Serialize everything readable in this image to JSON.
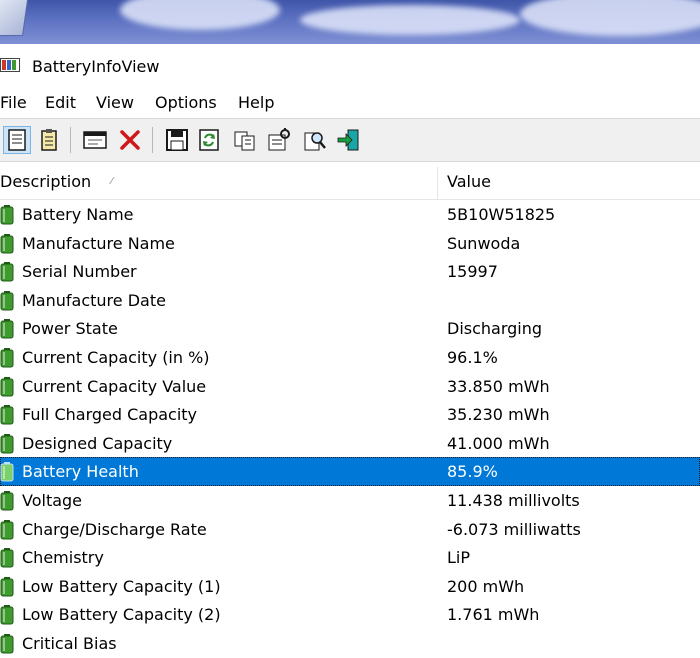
{
  "window": {
    "title": "BatteryInfoView"
  },
  "menu": [
    "File",
    "Edit",
    "View",
    "Options",
    "Help"
  ],
  "toolbar": [
    "properties-icon",
    "html-report-icon",
    "options-window-icon",
    "delete-icon",
    "save-icon",
    "refresh-icon",
    "copy-icon",
    "properties-dialog-icon",
    "find-icon",
    "exit-icon"
  ],
  "columns": {
    "description": "Description",
    "value": "Value"
  },
  "colors": {
    "selection": "#0078d7",
    "battery_green": "#3f9a2f"
  },
  "rows": [
    {
      "description": "Battery Name",
      "value": "5B10W51825"
    },
    {
      "description": "Manufacture Name",
      "value": "Sunwoda"
    },
    {
      "description": "Serial Number",
      "value": "15997"
    },
    {
      "description": "Manufacture Date",
      "value": ""
    },
    {
      "description": "Power State",
      "value": "Discharging"
    },
    {
      "description": "Current Capacity (in %)",
      "value": "96.1%"
    },
    {
      "description": "Current Capacity Value",
      "value": "33.850 mWh"
    },
    {
      "description": "Full Charged Capacity",
      "value": "35.230 mWh"
    },
    {
      "description": "Designed Capacity",
      "value": "41.000 mWh"
    },
    {
      "description": "Battery Health",
      "value": "85.9%",
      "selected": true
    },
    {
      "description": "Voltage",
      "value": "11.438 millivolts"
    },
    {
      "description": "Charge/Discharge Rate",
      "value": "-6.073 milliwatts"
    },
    {
      "description": "Chemistry",
      "value": "LiP"
    },
    {
      "description": "Low Battery Capacity (1)",
      "value": "200 mWh"
    },
    {
      "description": "Low Battery Capacity (2)",
      "value": "1.761 mWh"
    },
    {
      "description": "Critical Bias",
      "value": ""
    }
  ]
}
